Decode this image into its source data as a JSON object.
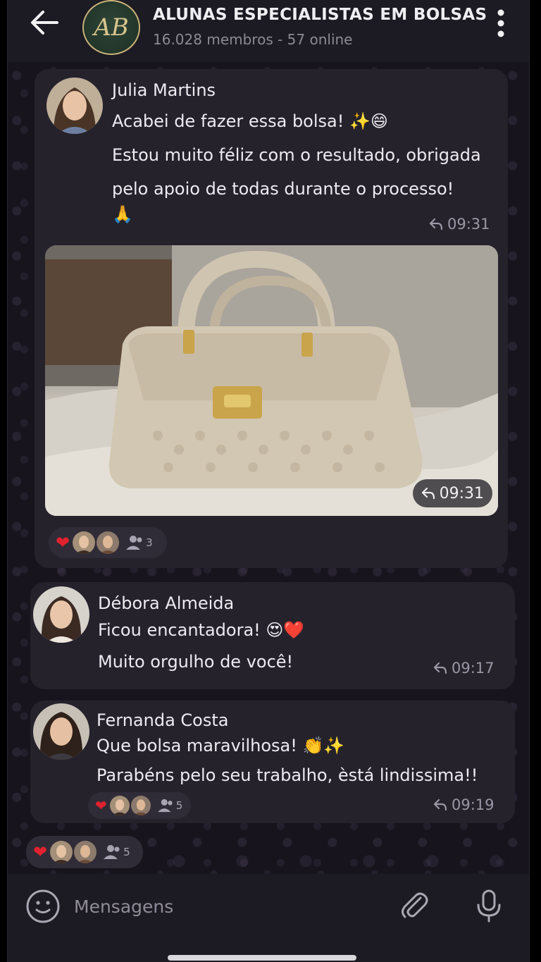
{
  "header": {
    "title": "ALUNAS ESPECIALISTAS EM BOLSAS",
    "subtitle": "16.028 membros - 57 online",
    "avatar_monogram": "AB"
  },
  "messages": [
    {
      "sender": "Julia Martins",
      "lines": [
        "Acabei de fazer essa bolsa! ✨😄",
        "Estou muito féliz com o resultado, obrigada",
        "pelo apoio de todas durante o processo!",
        "🙏"
      ],
      "time": "09:31",
      "photo_time": "09:31",
      "reaction_count": "3"
    },
    {
      "sender": "Débora Almeida",
      "lines": [
        "Ficou encantadora! 😍❤️",
        "Muito orgulho de você!"
      ],
      "time": "09:17"
    },
    {
      "sender": "Fernanda Costa",
      "lines": [
        "Que bolsa maravilhosa! 👏✨",
        "Parabéns pelo seu trabalho, èstá lindissima!!"
      ],
      "time": "09:19",
      "reaction_count": "5"
    }
  ],
  "bottom_reactions": {
    "count": "5"
  },
  "input": {
    "placeholder": "Mensagens"
  },
  "colors": {
    "background": "#16141c",
    "bubble": "#25222c",
    "heart": "#e0222e",
    "accent_gold": "#c9b27a"
  }
}
